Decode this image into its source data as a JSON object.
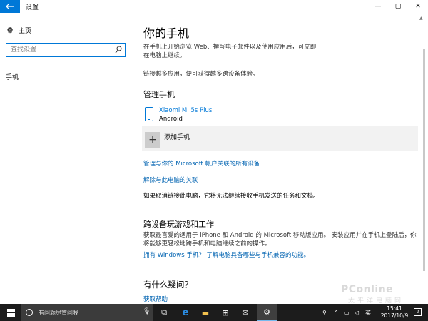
{
  "window": {
    "title": "设置",
    "back_icon": "arrow-left-icon",
    "minimize": "—",
    "maximize": "▢",
    "close": "✕"
  },
  "nav": {
    "home_label": "主页",
    "search_placeholder": "查找设置",
    "phone_label": "手机"
  },
  "main": {
    "title": "你的手机",
    "intro": "在手机上开始浏览 Web、撰写电子邮件以及使用应用后，可立即在电脑上继续。",
    "intro2": "链接越多应用，便可获得越多跨设备体验。",
    "manage_heading": "管理手机",
    "device": {
      "name": "Xiaomi MI 5s Plus",
      "os": "Android"
    },
    "add_phone_label": "添加手机",
    "link_manage_all": "管理与你的 Microsoft 帐户关联的所有设备",
    "link_unlink": "解除与此电脑的关联",
    "unlink_note": "如果取消链接此电脑，它将无法继续接收手机发送的任务和文档。",
    "cross_heading": "跨设备玩游戏和工作",
    "cross_text": "获取最喜爱的适用于 iPhone 和 Android 的 Microsoft 移动版应用。 安装应用并在手机上登陆后，你将能够更轻松地跨手机和电脑继续之前的操作。",
    "link_windows_phone": "拥有 Windows 手机？ 了解电脑具备哪些与手机兼容的功能。",
    "help_heading": "有什么疑问？",
    "link_help": "获取帮助"
  },
  "watermark": {
    "text": "PConline",
    "sub": "太平洋电脑网"
  },
  "taskbar": {
    "cortana_text": "有问题尽管问我",
    "clock_time": "15:41",
    "clock_date": "2017/10/9",
    "tray_ime": "英",
    "notification_count": "2"
  },
  "colors": {
    "accent": "#0078d7",
    "link": "#0063b1",
    "taskbar": "#1c1c1c"
  }
}
